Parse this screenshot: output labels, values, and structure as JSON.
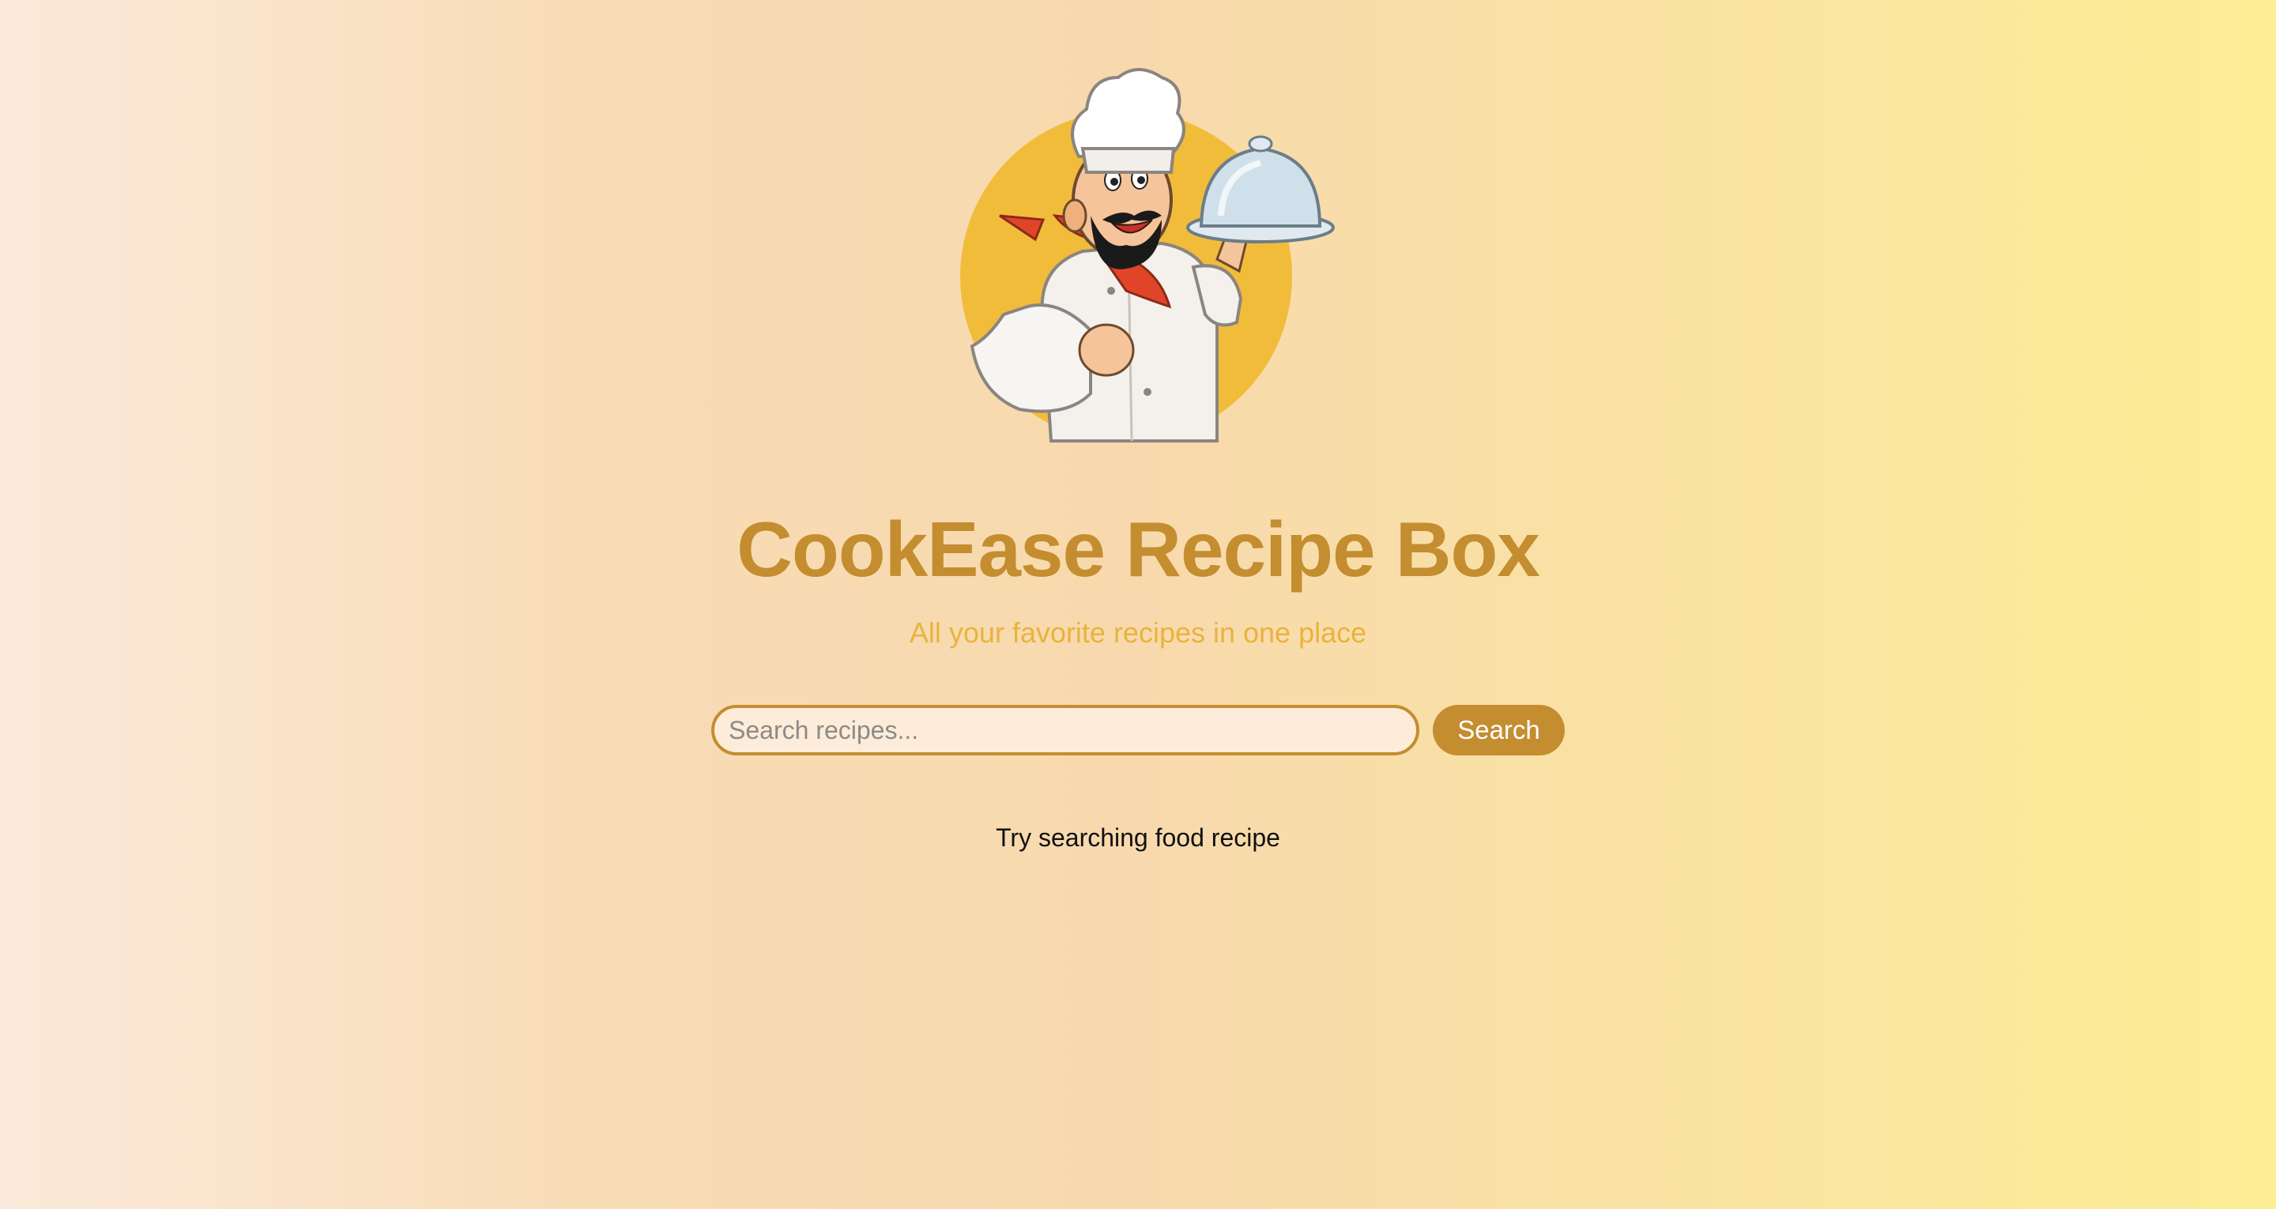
{
  "header": {
    "logo_icon": "chef-mascot-holding-cloche",
    "title": "CookEase Recipe Box",
    "subtitle": "All your favorite recipes in one place"
  },
  "search": {
    "placeholder": "Search recipes...",
    "value": "",
    "button_label": "Search"
  },
  "results": {
    "hint": "Try searching food recipe"
  },
  "colors": {
    "accent": "#c48d2f",
    "subtitle": "#e9b33c",
    "logo_circle": "#f2bc3b",
    "scarf": "#e0452a"
  }
}
